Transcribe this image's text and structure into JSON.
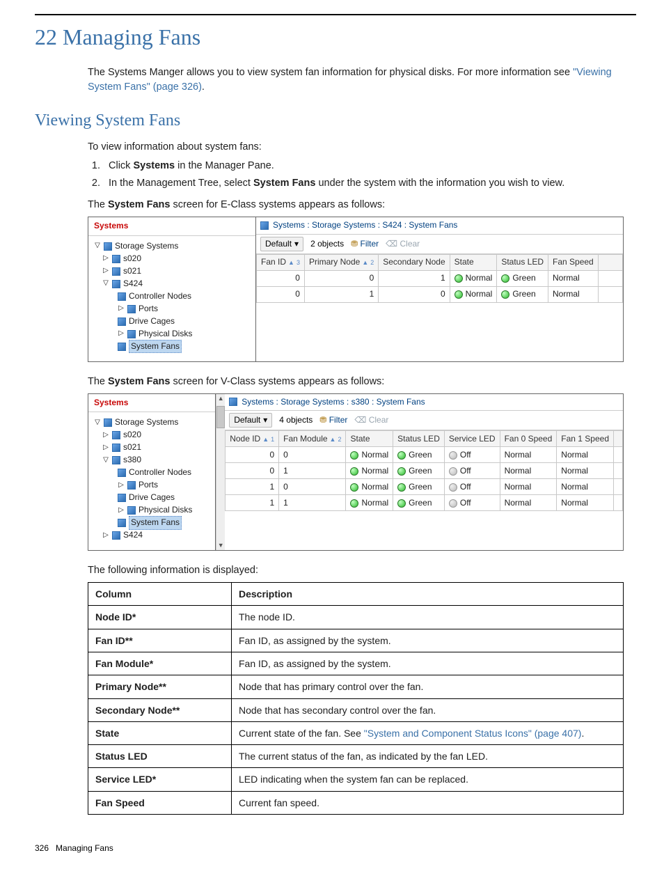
{
  "page": {
    "chapter_title": "22 Managing Fans",
    "intro_pre": "The Systems Manger allows you to view system fan information for physical disks. For more information see ",
    "intro_link": "\"Viewing System Fans\" (page 326)",
    "intro_post": ".",
    "h2": "Viewing System Fans",
    "view_intro": "To view information about system fans:",
    "step1_pre": "Click ",
    "step1_bold": "Systems",
    "step1_post": " in the Manager Pane.",
    "step2_pre": "In the Management Tree, select ",
    "step2_bold": "System Fans",
    "step2_post": " under the system with the information you wish to view.",
    "caption1_pre": "The ",
    "caption1_bold": "System Fans",
    "caption1_post": " screen for E-Class systems appears as follows:",
    "caption2_pre": "The ",
    "caption2_bold": "System Fans",
    "caption2_post": " screen for V-Class systems appears as follows:",
    "info_intro": "The following information is displayed:",
    "footer_page": "326",
    "footer_title": "Managing Fans"
  },
  "shot1": {
    "tree_head": "Systems",
    "items": {
      "storage": "Storage Systems",
      "s020": "s020",
      "s021": "s021",
      "s424": "S424",
      "ctrl": "Controller Nodes",
      "ports": "Ports",
      "cages": "Drive Cages",
      "disks": "Physical Disks",
      "fans": "System Fans"
    },
    "breadcrumb": "Systems : Storage Systems : S424 : System Fans",
    "toolbar": {
      "default": "Default",
      "count": "2 objects",
      "filter": "Filter",
      "clear": "Clear"
    },
    "headers": {
      "fan_id": "Fan ID",
      "sort1": "3",
      "primary": "Primary Node",
      "sort2": "2",
      "secondary": "Secondary Node",
      "state": "State",
      "status": "Status LED",
      "speed": "Fan Speed"
    },
    "rows": [
      {
        "fan": "0",
        "pri": "0",
        "sec": "1",
        "state": "Normal",
        "status": "Green",
        "speed": "Normal"
      },
      {
        "fan": "0",
        "pri": "1",
        "sec": "0",
        "state": "Normal",
        "status": "Green",
        "speed": "Normal"
      }
    ]
  },
  "shot2": {
    "tree_head": "Systems",
    "items": {
      "storage": "Storage Systems",
      "s020": "s020",
      "s021": "s021",
      "s380": "s380",
      "ctrl": "Controller Nodes",
      "ports": "Ports",
      "cages": "Drive Cages",
      "disks": "Physical Disks",
      "fans": "System Fans",
      "s424": "S424"
    },
    "breadcrumb": "Systems : Storage Systems : s380 : System Fans",
    "toolbar": {
      "default": "Default",
      "count": "4 objects",
      "filter": "Filter",
      "clear": "Clear"
    },
    "headers": {
      "node": "Node ID",
      "sort1": "1",
      "module": "Fan Module",
      "sort2": "2",
      "state": "State",
      "status": "Status LED",
      "service": "Service LED",
      "f0": "Fan 0 Speed",
      "f1": "Fan 1 Speed"
    },
    "rows": [
      {
        "node": "0",
        "mod": "0",
        "state": "Normal",
        "status": "Green",
        "service": "Off",
        "f0": "Normal",
        "f1": "Normal"
      },
      {
        "node": "0",
        "mod": "1",
        "state": "Normal",
        "status": "Green",
        "service": "Off",
        "f0": "Normal",
        "f1": "Normal"
      },
      {
        "node": "1",
        "mod": "0",
        "state": "Normal",
        "status": "Green",
        "service": "Off",
        "f0": "Normal",
        "f1": "Normal"
      },
      {
        "node": "1",
        "mod": "1",
        "state": "Normal",
        "status": "Green",
        "service": "Off",
        "f0": "Normal",
        "f1": "Normal"
      }
    ]
  },
  "info_table": {
    "h1": "Column",
    "h2": "Description",
    "rows": [
      {
        "c": "Node ID*",
        "d": "The node ID."
      },
      {
        "c": "Fan ID**",
        "d": "Fan ID, as assigned by the system."
      },
      {
        "c": "Fan Module*",
        "d": "Fan ID, as assigned by the system."
      },
      {
        "c": "Primary Node**",
        "d": "Node that has primary control over the fan."
      },
      {
        "c": "Secondary Node**",
        "d": "Node that has secondary control over the fan."
      },
      {
        "c": "State",
        "dpre": "Current state of the fan. See ",
        "dlink": "\"System and Component Status Icons\" (page 407)",
        "dpost": "."
      },
      {
        "c": "Status LED",
        "d": "The current status of the fan, as indicated by the fan LED."
      },
      {
        "c": "Service LED*",
        "d": "LED indicating when the system fan can be replaced."
      },
      {
        "c": "Fan Speed",
        "d": "Current fan speed."
      }
    ]
  }
}
